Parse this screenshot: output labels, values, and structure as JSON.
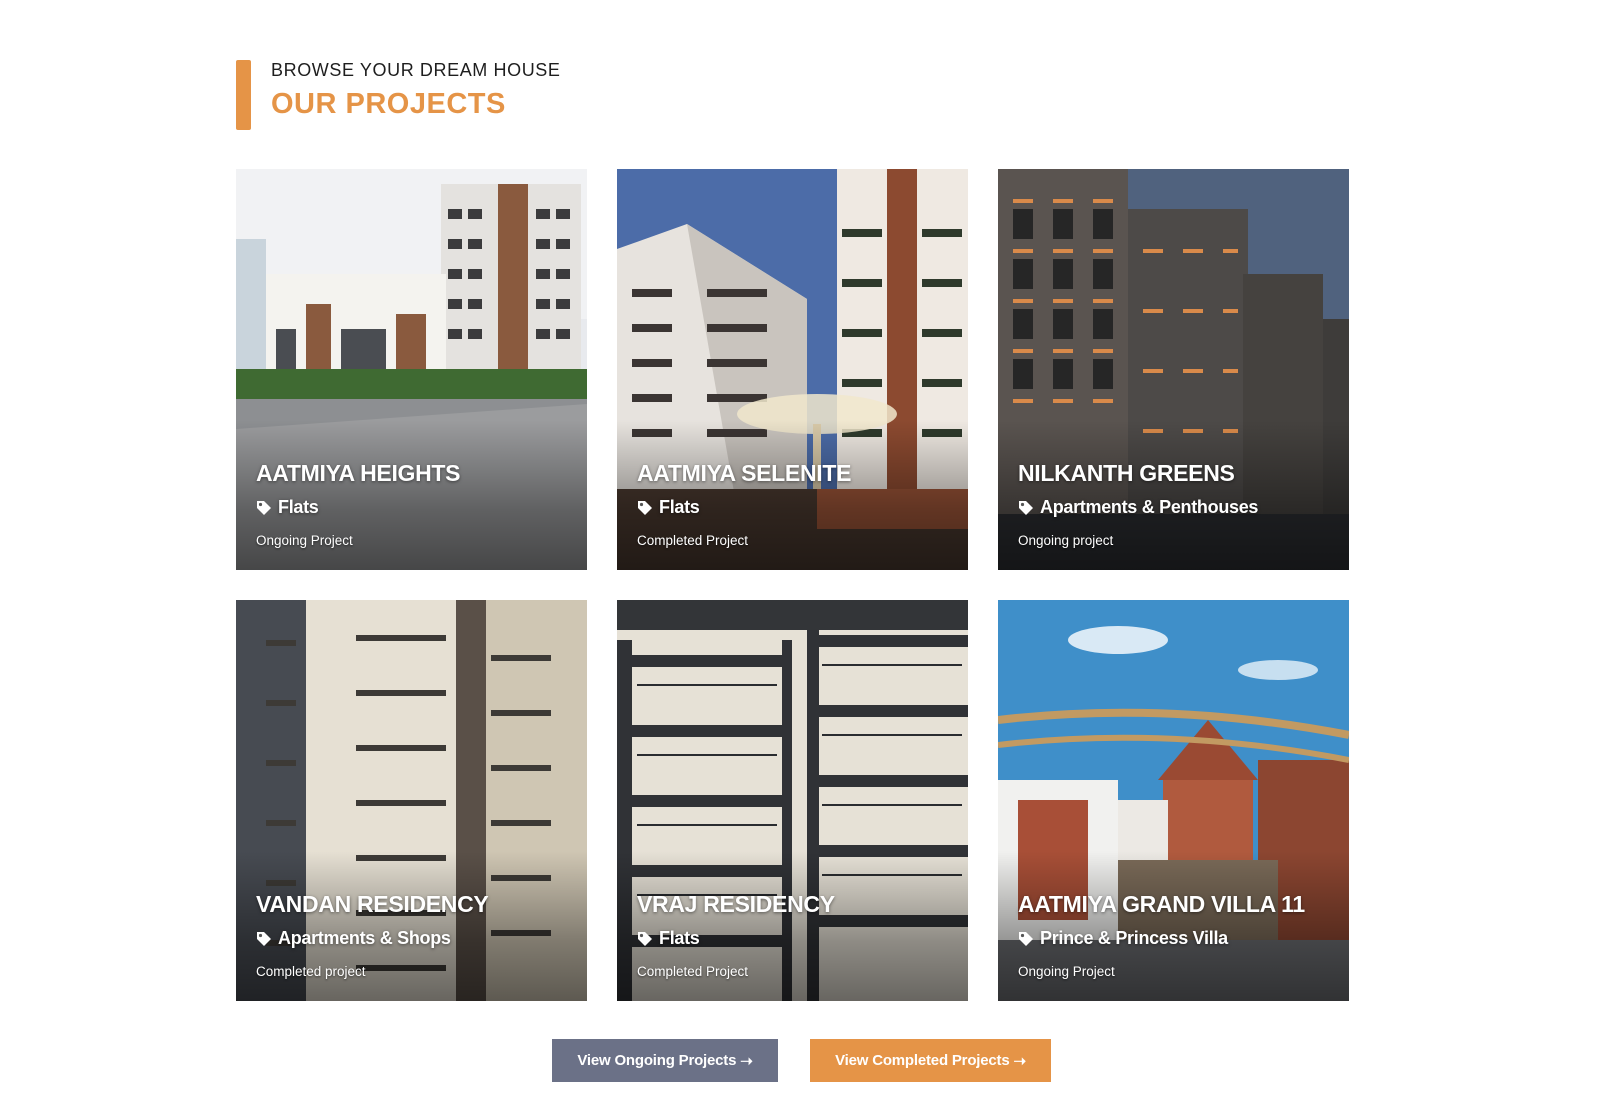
{
  "header": {
    "eyebrow": "BROWSE YOUR DREAM HOUSE",
    "title": "OUR PROJECTS",
    "accent_color": "#e59447"
  },
  "projects": [
    {
      "name": "AATMIYA HEIGHTS",
      "type": "Flats",
      "status": "Ongoing Project",
      "icon": "tag-icon"
    },
    {
      "name": "AATMIYA SELENITE",
      "type": "Flats",
      "status": "Completed Project",
      "icon": "tag-icon"
    },
    {
      "name": "NILKANTH GREENS",
      "type": "Apartments & Penthouses",
      "status": "Ongoing project",
      "icon": "tag-icon"
    },
    {
      "name": "VANDAN RESIDENCY",
      "type": "Apartments & Shops",
      "status": "Completed project",
      "icon": "tag-icon"
    },
    {
      "name": "VRAJ RESIDENCY",
      "type": "Flats",
      "status": "Completed Project",
      "icon": "tag-icon"
    },
    {
      "name": "AATMIYA GRAND VILLA 11",
      "type": "Prince & Princess Villa",
      "status": "Ongoing Project",
      "icon": "tag-icon"
    }
  ],
  "buttons": {
    "ongoing": {
      "label": "View Ongoing Projects",
      "icon": "arrow-right-icon",
      "color": "#6b7187"
    },
    "completed": {
      "label": "View Completed Projects",
      "icon": "arrow-right-icon",
      "color": "#e59447"
    }
  }
}
